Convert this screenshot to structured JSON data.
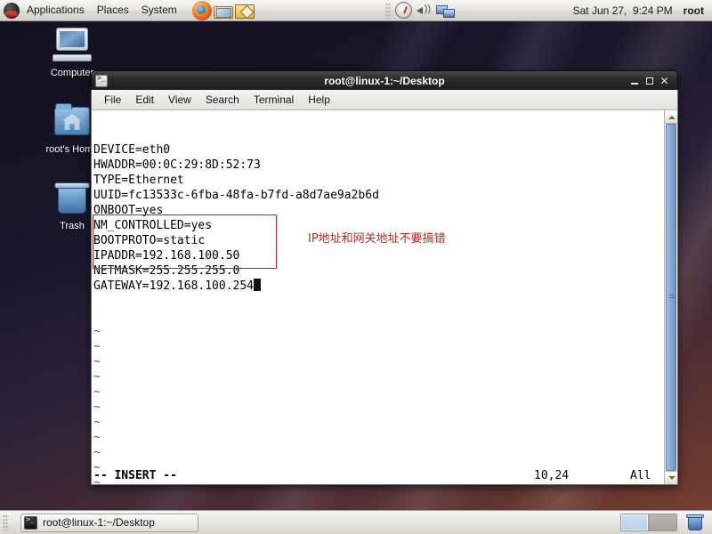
{
  "top_panel": {
    "logo": "redhat-logo",
    "menus": [
      "Applications",
      "Places",
      "System"
    ],
    "launchers": [
      {
        "name": "firefox-icon",
        "label": "Firefox Web Browser"
      },
      {
        "name": "evolution-mail-icon",
        "label": "Evolution Mail"
      },
      {
        "name": "text-editor-icon",
        "label": "Text Editor"
      }
    ],
    "tray": [
      {
        "name": "system-monitor-icon"
      },
      {
        "name": "volume-icon"
      },
      {
        "name": "network-icon"
      }
    ],
    "clock": "Sat Jun 27,  9:24 PM",
    "user": "root"
  },
  "desktop_icons": [
    {
      "name": "computer-icon",
      "label": "Computer"
    },
    {
      "name": "home-folder-icon",
      "label": "root's Home"
    },
    {
      "name": "trash-icon",
      "label": "Trash"
    }
  ],
  "terminal": {
    "title": "root@linux-1:~/Desktop",
    "window_icon": "terminal-icon",
    "window_buttons": {
      "minimize": "_",
      "maximize": "□",
      "close": "✕"
    },
    "menubar": [
      "File",
      "Edit",
      "View",
      "Search",
      "Terminal",
      "Help"
    ],
    "editor_lines": [
      "DEVICE=eth0",
      "HWADDR=00:0C:29:8D:52:73",
      "TYPE=Ethernet",
      "UUID=fc13533c-6fba-48fa-b7fd-a8d7ae9a2b6d",
      "ONBOOT=yes",
      "NM_CONTROLLED=yes",
      "BOOTPROTO=static",
      "IPADDR=192.168.100.50",
      "NETMASK=255.255.255.0",
      "GATEWAY=192.168.100.254"
    ],
    "tilde_count": 13,
    "tilde_char": "~",
    "annotation": "IP地址和网关地址不要搞错",
    "annotation_color": "#b02c20",
    "status": {
      "mode": "-- INSERT --",
      "position": "10,24",
      "scroll": "All"
    }
  },
  "bottom_panel": {
    "task_button": {
      "label": "root@linux-1:~/Desktop",
      "icon": "terminal-icon"
    },
    "workspaces": [
      {
        "name": "workspace-1",
        "active": true
      },
      {
        "name": "workspace-2",
        "active": false
      }
    ],
    "trash_applet": "trash-icon"
  }
}
